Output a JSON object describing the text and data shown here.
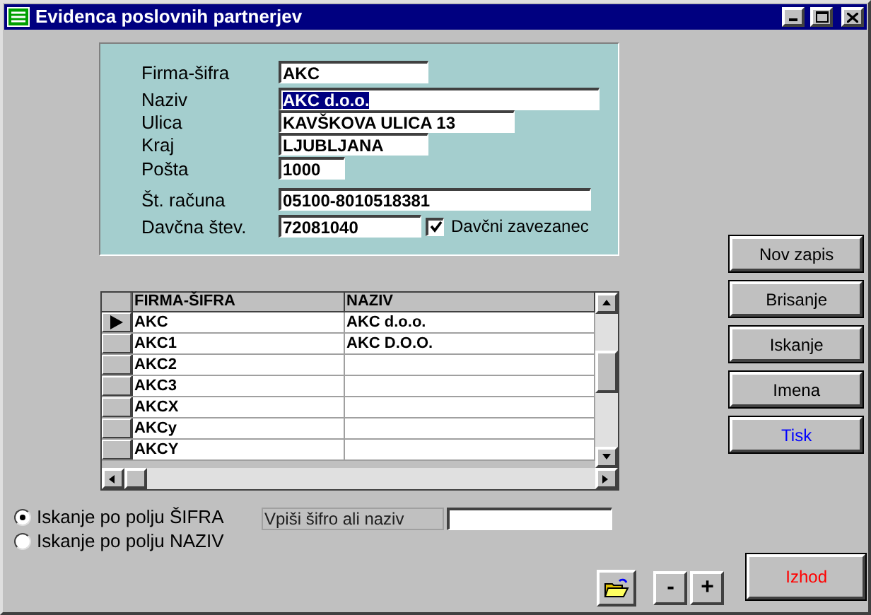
{
  "window": {
    "title": "Evidenca poslovnih partnerjev"
  },
  "form": {
    "fields": [
      {
        "label": "Firma-šifra",
        "value": "AKC",
        "text_selected": false
      },
      {
        "label": "Naziv",
        "value": "AKC d.o.o.",
        "text_selected": true
      },
      {
        "label": "Ulica",
        "value": "KAVŠKOVA ULICA 13",
        "text_selected": false
      },
      {
        "label": "Kraj",
        "value": "LJUBLJANA",
        "text_selected": false
      },
      {
        "label": "Pošta",
        "value": "1000",
        "text_selected": false
      },
      {
        "label": "Št. računa",
        "value": "05100-8010518381",
        "text_selected": false
      },
      {
        "label": "Davčna štev.",
        "value": "72081040",
        "text_selected": false
      }
    ],
    "checkbox": {
      "label": "Davčni zavezanec",
      "checked": true
    }
  },
  "grid": {
    "columns": [
      "FIRMA-ŠIFRA",
      "NAZIV"
    ],
    "rows": [
      {
        "cells": [
          "AKC",
          "AKC d.o.o."
        ],
        "selected": true
      },
      {
        "cells": [
          "AKC1",
          "AKC D.O.O."
        ],
        "selected": false
      },
      {
        "cells": [
          "AKC2",
          ""
        ],
        "selected": false
      },
      {
        "cells": [
          "AKC3",
          ""
        ],
        "selected": false
      },
      {
        "cells": [
          "AKCX",
          ""
        ],
        "selected": false
      },
      {
        "cells": [
          "AKCy",
          ""
        ],
        "selected": false
      },
      {
        "cells": [
          "AKCY",
          ""
        ],
        "selected": false
      }
    ]
  },
  "side_buttons": [
    {
      "label": "Nov zapis",
      "color": "#000000"
    },
    {
      "label": "Brisanje",
      "color": "#000000"
    },
    {
      "label": "Iskanje",
      "color": "#000000"
    },
    {
      "label": "Imena",
      "color": "#000000"
    },
    {
      "label": "Tisk",
      "color": "#0000ff"
    }
  ],
  "search": {
    "options": [
      {
        "label": "Iskanje po polju ŠIFRA",
        "selected": true
      },
      {
        "label": "Iskanje po polju NAZIV",
        "selected": false
      }
    ],
    "label": "Vpiši šifro ali naziv"
  },
  "bottom_buttons": [
    {
      "label": "-"
    },
    {
      "label": "+"
    }
  ],
  "exit_button": {
    "label": "Izhod",
    "color": "#ff0000"
  }
}
